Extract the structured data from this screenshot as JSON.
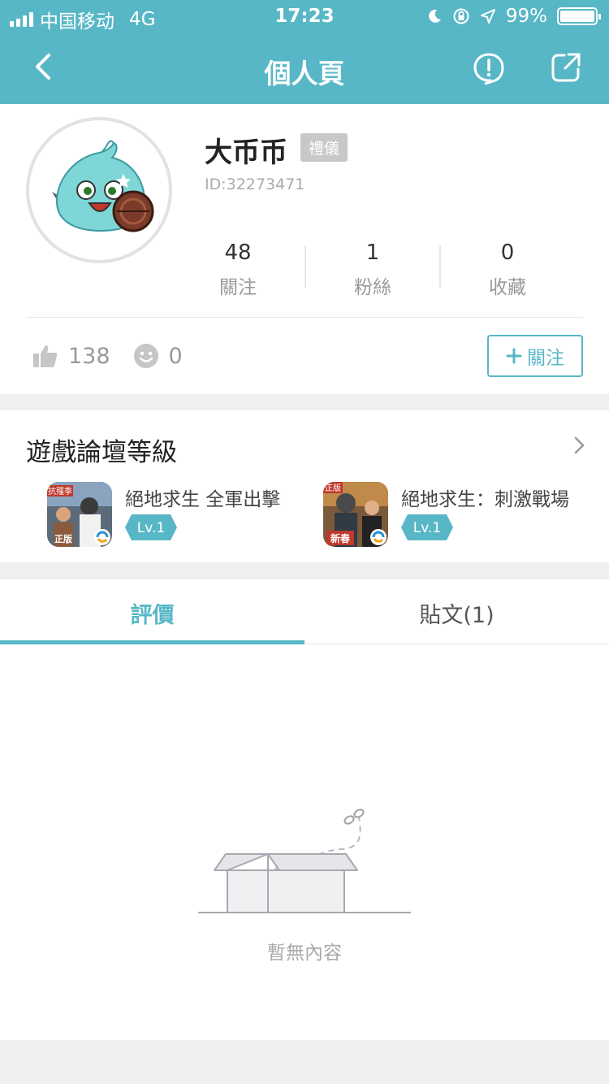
{
  "status_bar": {
    "carrier": "中国移动",
    "network": "4G",
    "time": "17:23",
    "battery": "99%"
  },
  "nav": {
    "title": "個人頁",
    "icons": [
      "back-icon",
      "report-icon",
      "share-icon"
    ]
  },
  "profile": {
    "name": "大币币",
    "badge": "禮儀",
    "id": "ID:32273471",
    "stats": [
      {
        "value": "48",
        "label": "關注"
      },
      {
        "value": "1",
        "label": "粉絲"
      },
      {
        "value": "0",
        "label": "收藏"
      }
    ],
    "likes": "138",
    "dislikes": "0",
    "follow_label": "關注"
  },
  "forum": {
    "title": "遊戲論壇等級",
    "games": [
      {
        "name": "絕地求生 全軍出擊",
        "level": "Lv.1",
        "icon_text": "正版",
        "icon_tag": "抗殭季"
      },
      {
        "name": "絕地求生：刺激戰場",
        "level": "Lv.1",
        "icon_text": "新春",
        "icon_tag": "正版"
      }
    ]
  },
  "tabs": [
    {
      "label": "評價",
      "active": true
    },
    {
      "label": "貼文(1)",
      "active": false
    }
  ],
  "empty_state": {
    "message": "暫無內容"
  },
  "colors": {
    "accent": "#58b7c6",
    "badge": "#c8c8c8"
  }
}
